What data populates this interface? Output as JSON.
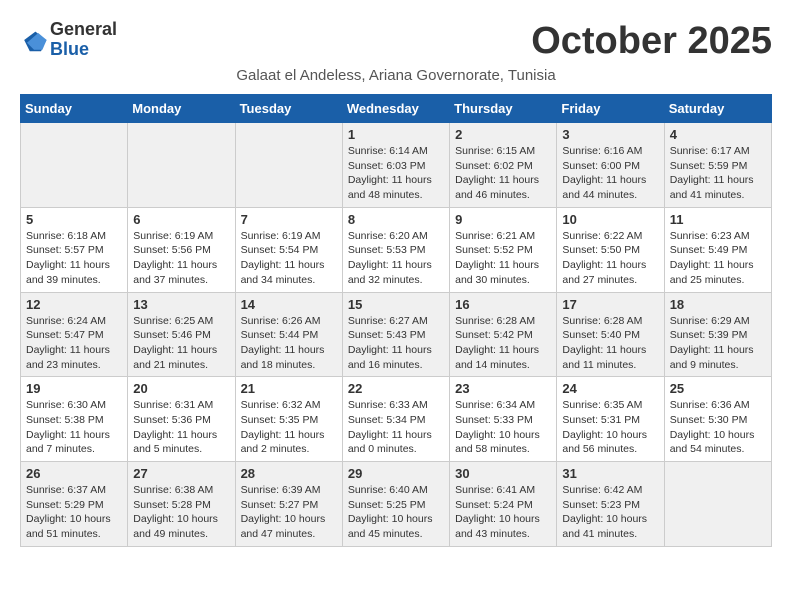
{
  "header": {
    "logo_general": "General",
    "logo_blue": "Blue",
    "month": "October 2025",
    "subtitle": "Galaat el Andeless, Ariana Governorate, Tunisia"
  },
  "weekdays": [
    "Sunday",
    "Monday",
    "Tuesday",
    "Wednesday",
    "Thursday",
    "Friday",
    "Saturday"
  ],
  "weeks": [
    [
      {
        "day": "",
        "info": ""
      },
      {
        "day": "",
        "info": ""
      },
      {
        "day": "",
        "info": ""
      },
      {
        "day": "1",
        "info": "Sunrise: 6:14 AM\nSunset: 6:03 PM\nDaylight: 11 hours and 48 minutes."
      },
      {
        "day": "2",
        "info": "Sunrise: 6:15 AM\nSunset: 6:02 PM\nDaylight: 11 hours and 46 minutes."
      },
      {
        "day": "3",
        "info": "Sunrise: 6:16 AM\nSunset: 6:00 PM\nDaylight: 11 hours and 44 minutes."
      },
      {
        "day": "4",
        "info": "Sunrise: 6:17 AM\nSunset: 5:59 PM\nDaylight: 11 hours and 41 minutes."
      }
    ],
    [
      {
        "day": "5",
        "info": "Sunrise: 6:18 AM\nSunset: 5:57 PM\nDaylight: 11 hours and 39 minutes."
      },
      {
        "day": "6",
        "info": "Sunrise: 6:19 AM\nSunset: 5:56 PM\nDaylight: 11 hours and 37 minutes."
      },
      {
        "day": "7",
        "info": "Sunrise: 6:19 AM\nSunset: 5:54 PM\nDaylight: 11 hours and 34 minutes."
      },
      {
        "day": "8",
        "info": "Sunrise: 6:20 AM\nSunset: 5:53 PM\nDaylight: 11 hours and 32 minutes."
      },
      {
        "day": "9",
        "info": "Sunrise: 6:21 AM\nSunset: 5:52 PM\nDaylight: 11 hours and 30 minutes."
      },
      {
        "day": "10",
        "info": "Sunrise: 6:22 AM\nSunset: 5:50 PM\nDaylight: 11 hours and 27 minutes."
      },
      {
        "day": "11",
        "info": "Sunrise: 6:23 AM\nSunset: 5:49 PM\nDaylight: 11 hours and 25 minutes."
      }
    ],
    [
      {
        "day": "12",
        "info": "Sunrise: 6:24 AM\nSunset: 5:47 PM\nDaylight: 11 hours and 23 minutes."
      },
      {
        "day": "13",
        "info": "Sunrise: 6:25 AM\nSunset: 5:46 PM\nDaylight: 11 hours and 21 minutes."
      },
      {
        "day": "14",
        "info": "Sunrise: 6:26 AM\nSunset: 5:44 PM\nDaylight: 11 hours and 18 minutes."
      },
      {
        "day": "15",
        "info": "Sunrise: 6:27 AM\nSunset: 5:43 PM\nDaylight: 11 hours and 16 minutes."
      },
      {
        "day": "16",
        "info": "Sunrise: 6:28 AM\nSunset: 5:42 PM\nDaylight: 11 hours and 14 minutes."
      },
      {
        "day": "17",
        "info": "Sunrise: 6:28 AM\nSunset: 5:40 PM\nDaylight: 11 hours and 11 minutes."
      },
      {
        "day": "18",
        "info": "Sunrise: 6:29 AM\nSunset: 5:39 PM\nDaylight: 11 hours and 9 minutes."
      }
    ],
    [
      {
        "day": "19",
        "info": "Sunrise: 6:30 AM\nSunset: 5:38 PM\nDaylight: 11 hours and 7 minutes."
      },
      {
        "day": "20",
        "info": "Sunrise: 6:31 AM\nSunset: 5:36 PM\nDaylight: 11 hours and 5 minutes."
      },
      {
        "day": "21",
        "info": "Sunrise: 6:32 AM\nSunset: 5:35 PM\nDaylight: 11 hours and 2 minutes."
      },
      {
        "day": "22",
        "info": "Sunrise: 6:33 AM\nSunset: 5:34 PM\nDaylight: 11 hours and 0 minutes."
      },
      {
        "day": "23",
        "info": "Sunrise: 6:34 AM\nSunset: 5:33 PM\nDaylight: 10 hours and 58 minutes."
      },
      {
        "day": "24",
        "info": "Sunrise: 6:35 AM\nSunset: 5:31 PM\nDaylight: 10 hours and 56 minutes."
      },
      {
        "day": "25",
        "info": "Sunrise: 6:36 AM\nSunset: 5:30 PM\nDaylight: 10 hours and 54 minutes."
      }
    ],
    [
      {
        "day": "26",
        "info": "Sunrise: 6:37 AM\nSunset: 5:29 PM\nDaylight: 10 hours and 51 minutes."
      },
      {
        "day": "27",
        "info": "Sunrise: 6:38 AM\nSunset: 5:28 PM\nDaylight: 10 hours and 49 minutes."
      },
      {
        "day": "28",
        "info": "Sunrise: 6:39 AM\nSunset: 5:27 PM\nDaylight: 10 hours and 47 minutes."
      },
      {
        "day": "29",
        "info": "Sunrise: 6:40 AM\nSunset: 5:25 PM\nDaylight: 10 hours and 45 minutes."
      },
      {
        "day": "30",
        "info": "Sunrise: 6:41 AM\nSunset: 5:24 PM\nDaylight: 10 hours and 43 minutes."
      },
      {
        "day": "31",
        "info": "Sunrise: 6:42 AM\nSunset: 5:23 PM\nDaylight: 10 hours and 41 minutes."
      },
      {
        "day": "",
        "info": ""
      }
    ]
  ],
  "shaded_weeks": [
    0,
    2,
    4
  ]
}
